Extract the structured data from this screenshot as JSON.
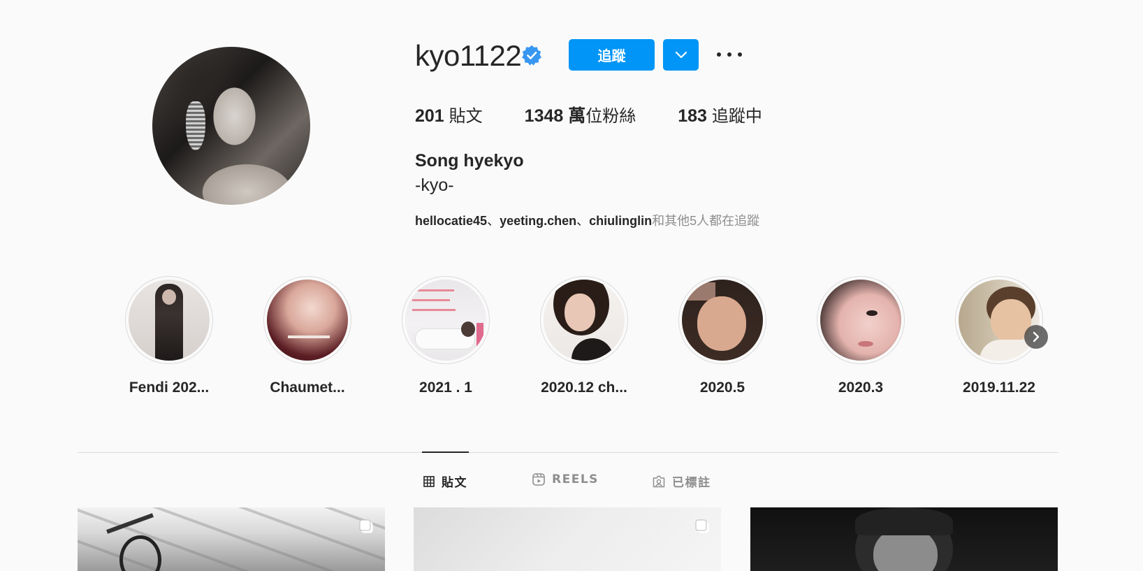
{
  "profile": {
    "username": "kyo1122",
    "verified": true,
    "follow_button": "追蹤",
    "stats": [
      {
        "value": "201",
        "label": "貼文"
      },
      {
        "value": "1348 萬",
        "label": "位粉絲"
      },
      {
        "value": "183",
        "label": "追蹤中"
      }
    ],
    "full_name": "Song hyekyo",
    "bio": "-kyo-",
    "followed_by": {
      "users": [
        "hellocatie45",
        "yeeting.chen",
        "chiulinglin"
      ],
      "separator": "、",
      "suffix": "和其他5人都在追蹤"
    }
  },
  "highlights": [
    {
      "label": "Fendi 202..."
    },
    {
      "label": "Chaumet..."
    },
    {
      "label": "2021 . 1"
    },
    {
      "label": "2020.12 ch..."
    },
    {
      "label": "2020.5"
    },
    {
      "label": "2020.3"
    },
    {
      "label": "2019.11.22"
    }
  ],
  "tabs": [
    {
      "label": "貼文",
      "icon": "grid-icon",
      "active": true
    },
    {
      "label": "REELS",
      "icon": "reels-icon",
      "active": false
    },
    {
      "label": "已標註",
      "icon": "tagged-icon",
      "active": false
    }
  ],
  "colors": {
    "accent": "#0095f6",
    "verified": "#3897f0",
    "text": "#262626",
    "muted": "#8e8e8e"
  }
}
